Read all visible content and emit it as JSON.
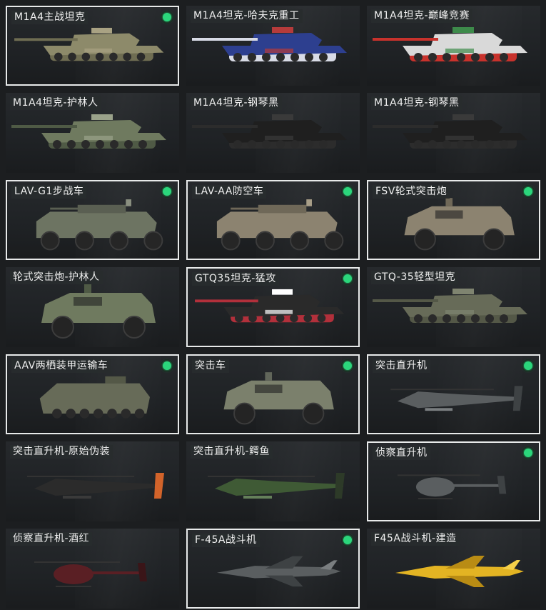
{
  "items": [
    {
      "label": "M1A4主战坦克",
      "selected": true,
      "equipped": true,
      "icon": "tank-icon",
      "camo": "desert-camo"
    },
    {
      "label": "M1A4坦克-哈夫克重工",
      "selected": false,
      "equipped": false,
      "icon": "tank-icon",
      "camo": "blue-white"
    },
    {
      "label": "M1A4坦克-巅峰竞赛",
      "selected": false,
      "equipped": false,
      "icon": "tank-icon",
      "camo": "red-white"
    },
    {
      "label": "M1A4坦克-护林人",
      "selected": false,
      "equipped": false,
      "icon": "tank-icon",
      "camo": "forest-camo"
    },
    {
      "label": "M1A4坦克-钢琴黑",
      "selected": false,
      "equipped": false,
      "icon": "tank-icon",
      "camo": "piano-black"
    },
    {
      "label": "M1A4坦克-钢琴黑",
      "selected": false,
      "equipped": false,
      "icon": "tank-icon",
      "camo": "piano-black"
    },
    {
      "label": "LAV-G1步战车",
      "selected": true,
      "equipped": true,
      "icon": "ifv-icon",
      "camo": "green-grey"
    },
    {
      "label": "LAV-AA防空车",
      "selected": true,
      "equipped": true,
      "icon": "ifv-icon",
      "camo": "tan"
    },
    {
      "label": "FSV轮式突击炮",
      "selected": true,
      "equipped": true,
      "icon": "armored-car-icon",
      "camo": "tan"
    },
    {
      "label": "轮式突击炮-护林人",
      "selected": false,
      "equipped": false,
      "icon": "armored-car-icon",
      "camo": "forest-camo"
    },
    {
      "label": "GTQ35坦克-猛攻",
      "selected": true,
      "equipped": true,
      "icon": "light-tank-icon",
      "camo": "red-black"
    },
    {
      "label": "GTQ-35轻型坦克",
      "selected": false,
      "equipped": false,
      "icon": "light-tank-icon",
      "camo": "olive"
    },
    {
      "label": "AAV两栖装甲运输车",
      "selected": true,
      "equipped": true,
      "icon": "amphibious-apc-icon",
      "camo": "olive"
    },
    {
      "label": "突击车",
      "selected": true,
      "equipped": true,
      "icon": "assault-vehicle-icon",
      "camo": "olive-grey"
    },
    {
      "label": "突击直升机",
      "selected": true,
      "equipped": true,
      "icon": "attack-helicopter-icon",
      "camo": "grey"
    },
    {
      "label": "突击直升机-原始伪装",
      "selected": false,
      "equipped": false,
      "icon": "attack-helicopter-icon",
      "camo": "orange-black"
    },
    {
      "label": "突击直升机-鳄鱼",
      "selected": false,
      "equipped": false,
      "icon": "attack-helicopter-icon",
      "camo": "green-camo"
    },
    {
      "label": "侦察直升机",
      "selected": true,
      "equipped": true,
      "icon": "scout-helicopter-icon",
      "camo": "grey"
    },
    {
      "label": "侦察直升机-酒红",
      "selected": false,
      "equipped": false,
      "icon": "scout-helicopter-icon",
      "camo": "wine-red"
    },
    {
      "label": "F-45A战斗机",
      "selected": true,
      "equipped": true,
      "icon": "fighter-jet-icon",
      "camo": "grey"
    },
    {
      "label": "F45A战斗机-建造",
      "selected": false,
      "equipped": false,
      "icon": "fighter-jet-icon",
      "camo": "yellow"
    }
  ],
  "colors": {
    "equipped_dot": "#2bd67b",
    "selected_border": "#e8eaea",
    "background": "#1c1e20"
  }
}
